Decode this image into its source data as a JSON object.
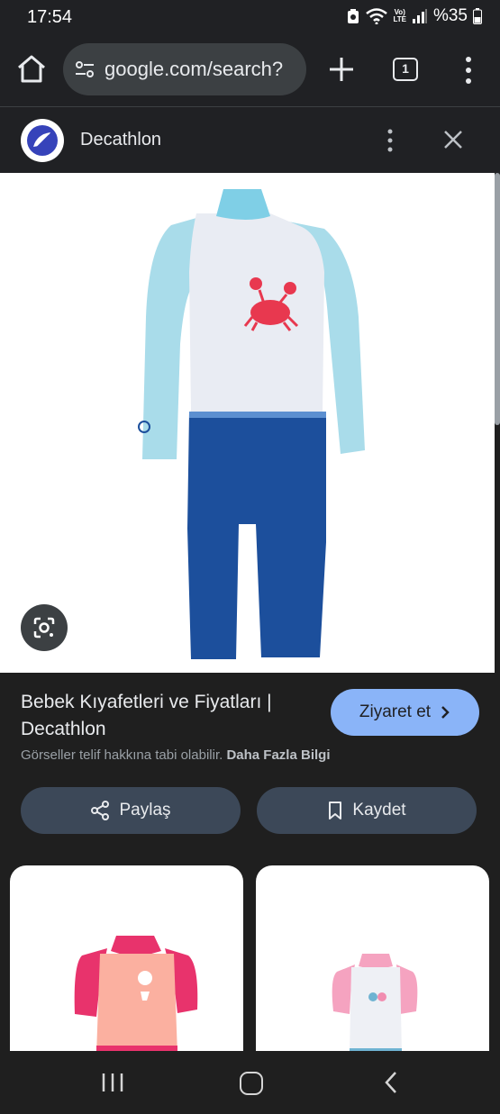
{
  "status_bar": {
    "time": "17:54",
    "lte_top": "Vo)",
    "lte_bottom": "LTE",
    "battery": "%35"
  },
  "toolbar": {
    "url": "google.com/search?",
    "tab_count": "1"
  },
  "source": {
    "name": "Decathlon",
    "logo_bg": "#ffffff",
    "logo_color": "#3643ba"
  },
  "result": {
    "title": "Bebek Kıyafetleri ve Fiyatları | Decathlon",
    "visit_label": "Ziyaret et",
    "copyright_text": "Görseller telif hakkına tabi olabilir.",
    "learn_more": "Daha Fazla Bilgi",
    "share_label": "Paylaş",
    "save_label": "Kaydet"
  },
  "colors": {
    "accent": "#8ab4f8",
    "pill_bg": "#3c4858",
    "background": "#1f1f1f"
  },
  "icons": {
    "home": "home-icon",
    "tune": "tune-icon",
    "plus": "plus-icon",
    "menu": "more-vert-icon",
    "close": "close-icon",
    "lens": "google-lens-icon",
    "share": "share-icon",
    "save": "bookmark-icon"
  }
}
